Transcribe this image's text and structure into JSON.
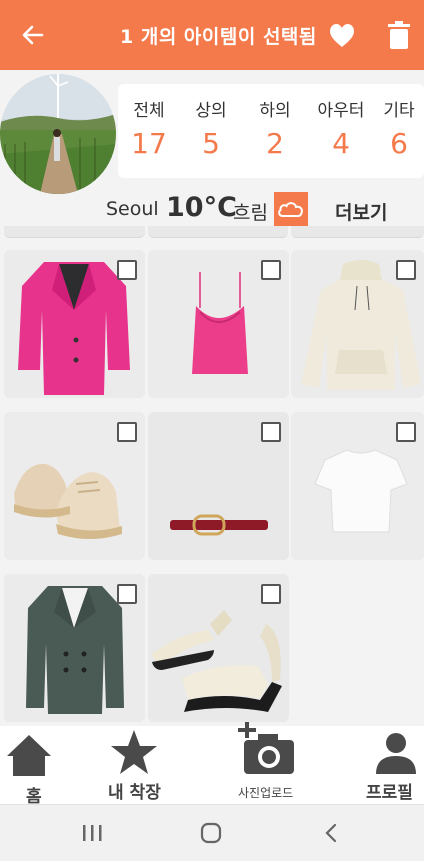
{
  "topbar": {
    "title": "1 개의 아이템이 선택됨",
    "icons": [
      "back-arrow-icon",
      "heart-icon",
      "trash-icon"
    ],
    "color": "#f47a4b"
  },
  "stats": [
    {
      "label": "전체",
      "value": "17"
    },
    {
      "label": "상의",
      "value": "5"
    },
    {
      "label": "하의",
      "value": "2"
    },
    {
      "label": "아우터",
      "value": "4"
    },
    {
      "label": "기타",
      "value": "6"
    }
  ],
  "weather": {
    "city": "Seoul",
    "temperature": "10°C",
    "condition": "흐림",
    "icon": "cloud-icon",
    "more_label": "더보기"
  },
  "items": [
    {
      "name": "pink-blazer",
      "checked": false
    },
    {
      "name": "pink-camisole",
      "checked": false
    },
    {
      "name": "cream-hoodie",
      "checked": false
    },
    {
      "name": "beige-sneakers",
      "checked": false
    },
    {
      "name": "red-belt",
      "checked": false
    },
    {
      "name": "white-tshirt",
      "checked": false
    },
    {
      "name": "green-blazer",
      "checked": false
    },
    {
      "name": "cream-sandals",
      "checked": false
    }
  ],
  "nav": {
    "home": "홈",
    "closet": "내 착장",
    "upload": "사진업로드",
    "profile": "프로필"
  },
  "colors": {
    "accent": "#f47a4b"
  }
}
